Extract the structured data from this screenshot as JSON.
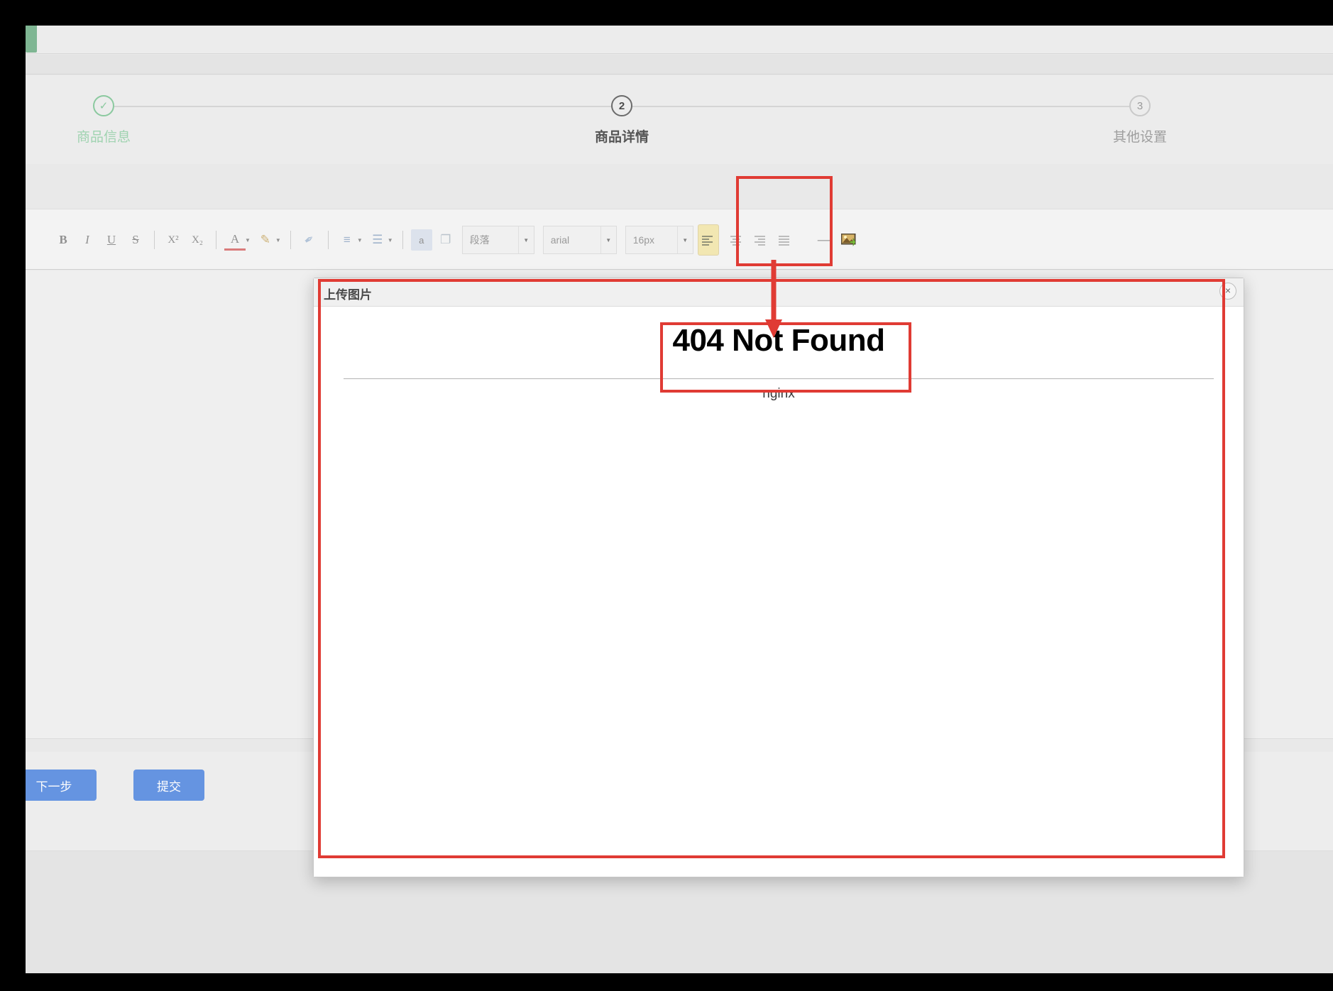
{
  "window": {
    "background_color": "#000000",
    "page_background": "#e9e9e9"
  },
  "wizard": {
    "steps": [
      {
        "number": "✓",
        "label": "商品信息",
        "state": "done"
      },
      {
        "number": "2",
        "label": "商品详情",
        "state": "active"
      },
      {
        "number": "3",
        "label": "其他设置",
        "state": "pending"
      }
    ],
    "done_color": "#8bc99f",
    "active_color": "#555555",
    "pending_color": "#9e9e9e"
  },
  "toolbar": {
    "buttons": [
      {
        "icon": "bold-icon",
        "glyph": "B"
      },
      {
        "icon": "italic-icon",
        "glyph": "I"
      },
      {
        "icon": "underline-icon",
        "glyph": "U"
      },
      {
        "icon": "strikethrough-icon",
        "glyph": "S"
      },
      {
        "icon": "superscript-icon",
        "glyph": "X²"
      },
      {
        "icon": "subscript-icon",
        "glyph": "X₂"
      },
      {
        "icon": "font-color-icon",
        "glyph": "A"
      },
      {
        "icon": "highlight-color-icon",
        "glyph": "✎"
      },
      {
        "icon": "eraser-icon",
        "glyph": "✒"
      },
      {
        "icon": "ordered-list-icon",
        "glyph": "≡"
      },
      {
        "icon": "unordered-list-icon",
        "glyph": "☰"
      },
      {
        "icon": "link-icon",
        "glyph": "a"
      },
      {
        "icon": "paste-icon",
        "glyph": "❐"
      }
    ],
    "selects": [
      {
        "name": "paragraph-select",
        "value": "段落"
      },
      {
        "name": "font-family-select",
        "value": "arial"
      },
      {
        "name": "font-size-select",
        "value": "16px"
      }
    ],
    "align_buttons": [
      {
        "icon": "align-left-icon",
        "active": true
      },
      {
        "icon": "align-center-icon",
        "active": false
      },
      {
        "icon": "align-right-icon",
        "active": false
      },
      {
        "icon": "align-justify-icon",
        "active": false
      }
    ],
    "insert_buttons": [
      {
        "icon": "horizontal-rule-icon",
        "glyph": "—"
      },
      {
        "icon": "insert-image-icon",
        "glyph": "▣"
      }
    ],
    "highlighted_button": "insert-image-icon"
  },
  "footer": {
    "next_label": "下一步",
    "submit_label": "提交",
    "button_color": "#5a8de0"
  },
  "dialog": {
    "title": "上传图片",
    "close_icon": "close-icon",
    "close_glyph": "×",
    "content": {
      "error_title": "404 Not Found",
      "server": "nginx"
    }
  },
  "annotations": {
    "color": "#e03b34",
    "boxes": [
      {
        "name": "toolbar-image-button-highlight",
        "target": "insert-image-icon"
      },
      {
        "name": "dialog-highlight",
        "target": "upload-image-dialog"
      },
      {
        "name": "error-title-highlight",
        "target": "error-title"
      }
    ],
    "arrow": {
      "name": "annotation-arrow",
      "from": "insert-image-icon",
      "to": "error-title"
    }
  }
}
